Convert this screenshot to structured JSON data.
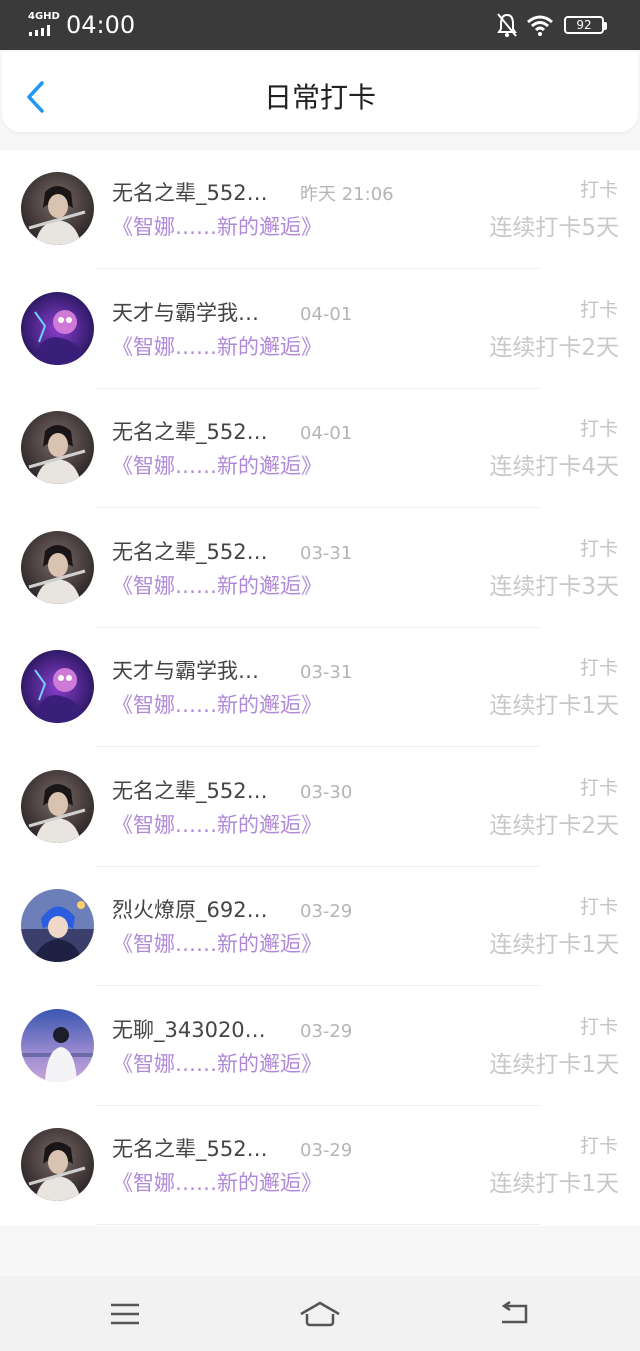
{
  "status_bar": {
    "network": "4GHD",
    "time": "04:00",
    "battery": "92"
  },
  "header": {
    "title": "日常打卡"
  },
  "colors": {
    "accent": "#2196f3",
    "book_title": "#b08ad8",
    "muted": "#c4c4c4"
  },
  "rows": [
    {
      "name": "无名之辈_552…",
      "date": "昨天 21:06",
      "book": "《智娜……新的邂逅》",
      "tag": "打卡",
      "streak": "连续打卡5天",
      "avatar": "avatar-man-dark"
    },
    {
      "name": "天才与霸学我…",
      "date": "04-01",
      "book": "《智娜……新的邂逅》",
      "tag": "打卡",
      "streak": "连续打卡2天",
      "avatar": "avatar-purple-demon"
    },
    {
      "name": "无名之辈_552…",
      "date": "04-01",
      "book": "《智娜……新的邂逅》",
      "tag": "打卡",
      "streak": "连续打卡4天",
      "avatar": "avatar-man-dark"
    },
    {
      "name": "无名之辈_552…",
      "date": "03-31",
      "book": "《智娜……新的邂逅》",
      "tag": "打卡",
      "streak": "连续打卡3天",
      "avatar": "avatar-man-dark"
    },
    {
      "name": "天才与霸学我…",
      "date": "03-31",
      "book": "《智娜……新的邂逅》",
      "tag": "打卡",
      "streak": "连续打卡1天",
      "avatar": "avatar-purple-demon"
    },
    {
      "name": "无名之辈_552…",
      "date": "03-30",
      "book": "《智娜……新的邂逅》",
      "tag": "打卡",
      "streak": "连续打卡2天",
      "avatar": "avatar-man-dark"
    },
    {
      "name": "烈火燎原_692…",
      "date": "03-29",
      "book": "《智娜……新的邂逅》",
      "tag": "打卡",
      "streak": "连续打卡1天",
      "avatar": "avatar-blue-hair"
    },
    {
      "name": "无聊_343020…",
      "date": "03-29",
      "book": "《智娜……新的邂逅》",
      "tag": "打卡",
      "streak": "连续打卡1天",
      "avatar": "avatar-sunset-person"
    },
    {
      "name": "无名之辈_552…",
      "date": "03-29",
      "book": "《智娜……新的邂逅》",
      "tag": "打卡",
      "streak": "连续打卡1天",
      "avatar": "avatar-man-dark"
    }
  ],
  "nav_bar": {
    "menu_icon": "menu-icon",
    "home_icon": "home-icon",
    "back_icon": "return-icon"
  }
}
